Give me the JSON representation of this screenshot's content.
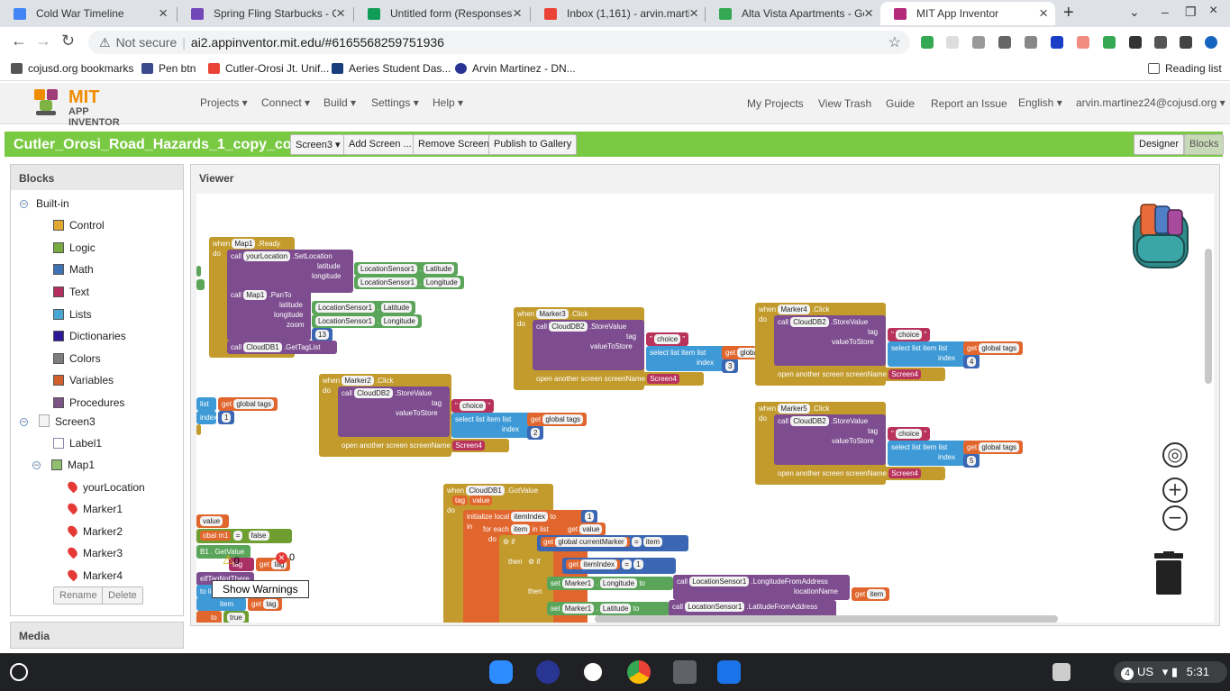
{
  "browser": {
    "tabs": [
      {
        "label": "Cold War Timeline",
        "icon": "google-docs-icon",
        "color": "#4285f4",
        "active": false
      },
      {
        "label": "Spring Fling Starbucks - Go",
        "icon": "google-forms-icon",
        "color": "#7248b9",
        "active": false
      },
      {
        "label": "Untitled form (Responses) -",
        "icon": "google-sheets-icon",
        "color": "#0f9d58",
        "active": false
      },
      {
        "label": "Inbox (1,161) - arvin.martin",
        "icon": "gmail-icon",
        "color": "#ea4335",
        "active": false
      },
      {
        "label": "Alta Vista Apartments - Goo",
        "icon": "google-maps-icon",
        "color": "#34a853",
        "active": false
      },
      {
        "label": "MIT App Inventor",
        "icon": "app-inventor-icon",
        "color": "#b5297a",
        "active": true
      }
    ],
    "address": {
      "security_label": "Not secure",
      "url": "ai2.appinventor.mit.edu/#6165568259751936"
    },
    "bookmarks": [
      {
        "label": "cojusd.org bookmarks",
        "icon": "folder-icon",
        "color": "#555555"
      },
      {
        "label": "Pen btn",
        "icon": "tci-icon",
        "color": "#3b4a8a"
      },
      {
        "label": "Cutler-Orosi Jt. Unif...",
        "icon": "gmail-icon",
        "color": "#ea4335"
      },
      {
        "label": "Aeries Student Das...",
        "icon": "aeries-icon",
        "color": "#1a3d7c"
      },
      {
        "label": "Arvin Martinez - DN...",
        "icon": "k-icon",
        "color": "#283593"
      }
    ],
    "reading_list": "Reading list"
  },
  "appinventor": {
    "logo_top": "MIT",
    "logo_bottom": "APP INVENTOR",
    "menus": [
      "Projects ▾",
      "Connect ▾",
      "Build ▾",
      "Settings ▾",
      "Help ▾"
    ],
    "right_links": [
      "My Projects",
      "View Trash",
      "Guide",
      "Report an Issue",
      "English ▾",
      "arvin.martinez24@cojusd.org ▾"
    ],
    "project_name": "Cutler_Orosi_Road_Hazards_1_copy_copy",
    "project_buttons": [
      "Screen3 ▾",
      "Add Screen ...",
      "Remove Screen",
      "Publish to Gallery"
    ],
    "mode_buttons": [
      "Designer",
      "Blocks"
    ],
    "blocks_panel": {
      "title": "Blocks",
      "builtin_label": "Built-in",
      "builtin": [
        {
          "label": "Control",
          "color": "#e1a933"
        },
        {
          "label": "Logic",
          "color": "#77ab41"
        },
        {
          "label": "Math",
          "color": "#3f71b5"
        },
        {
          "label": "Text",
          "color": "#b32d5e"
        },
        {
          "label": "Lists",
          "color": "#49a6d4"
        },
        {
          "label": "Dictionaries",
          "color": "#2d1799"
        },
        {
          "label": "Colors",
          "color": "#7d7d7d"
        },
        {
          "label": "Variables",
          "color": "#d05f2d"
        },
        {
          "label": "Procedures",
          "color": "#7c5385"
        }
      ],
      "screen": "Screen3",
      "components": [
        "Label1",
        "Map1"
      ],
      "markers": [
        "yourLocation",
        "Marker1",
        "Marker2",
        "Marker3",
        "Marker4"
      ],
      "rename_label": "Rename",
      "delete_label": "Delete"
    },
    "media_title": "Media",
    "viewer_title": "Viewer",
    "warnings": {
      "show_label": "Show Warnings",
      "warning_count": "0",
      "error_count": "0"
    },
    "blocks": {
      "map_ready": {
        "when": "when",
        "component": "Map1",
        "event": ".Ready",
        "do": "do",
        "call": "call",
        "set_loc_comp": "yourLocation",
        "set_loc": ".SetLocation",
        "latitude": "latitude",
        "longitude": "longitude",
        "sensor": "LocationSensor1",
        "lat_prop": "Latitude",
        "lon_prop": "Longitude",
        "pan_comp": "Map1",
        "pan": ".PanTo",
        "zoom": "zoom",
        "zoom_value": "13",
        "db_comp": "CloudDB1",
        "get_tags": ".GetTagList"
      },
      "store": {
        "click": ".Click",
        "db": "CloudDB2",
        "store_value": ".StoreValue",
        "tag": "tag",
        "choice": "choice",
        "value_to_store": "valueToStore",
        "select": "select list item  list",
        "get": "get",
        "global_tags": "global tags",
        "index": "index",
        "open_screen": "open another screen  screenName",
        "screen4": "Screen4"
      },
      "marker_indices": {
        "marker2": "2",
        "marker3": "3",
        "marker4": "4",
        "marker5": "5"
      },
      "marker_names": {
        "marker2": "Marker2",
        "marker3": "Marker3",
        "marker4": "Marker4",
        "marker5": "Marker5"
      },
      "left_fragments": {
        "list": "list",
        "get_global_tags": "global tags",
        "index": "index",
        "one": "1"
      },
      "got_value": {
        "when": "when",
        "component": "CloudDB1",
        "event": ".GotValue",
        "param_tag": "tag",
        "param_value": "value",
        "do": "do",
        "init_local": "initialize local",
        "item_index": "itemIndex",
        "to": "to",
        "one": "1",
        "in": "in",
        "for_each": "for each",
        "item": "item",
        "in_list": "in list",
        "get": "get",
        "value": "value",
        "do2": "do",
        "if": "if",
        "global_current_marker": "global currentMarker",
        "eq": "=",
        "then": "then",
        "set": "set",
        "marker1": "Marker1",
        "longitude": "Longitude",
        "latitude": "Latitude",
        "call": "call",
        "sensor": "LocationSensor1",
        "lon_from_addr": ".LongitudeFromAddress",
        "lat_from_addr": ".LatitudeFromAddress",
        "location_name": "locationName"
      },
      "lower_left": {
        "value": "value",
        "global_m1": "obal m1",
        "eq": "=",
        "false": "false",
        "get_value": "B1 . GetValue",
        "tag": "tag",
        "get": "get",
        "if_tag_not": "elfTagNotThere",
        "to_list": "to lis",
        "item": "item",
        "to": "to",
        "true": "true"
      }
    }
  },
  "taskbar": {
    "apps": [
      {
        "name": "zoom-icon",
        "color": "#2d8cff"
      },
      {
        "name": "k-icon",
        "color": "#283593"
      },
      {
        "name": "app-icon",
        "color": "#ffffff"
      },
      {
        "name": "chrome-icon",
        "color": "#4285f4"
      },
      {
        "name": "files-icon",
        "color": "#5f6368"
      },
      {
        "name": "files-blue-icon",
        "color": "#1a73e8"
      }
    ],
    "notification_count": "4",
    "region": "US",
    "time": "5:31"
  }
}
